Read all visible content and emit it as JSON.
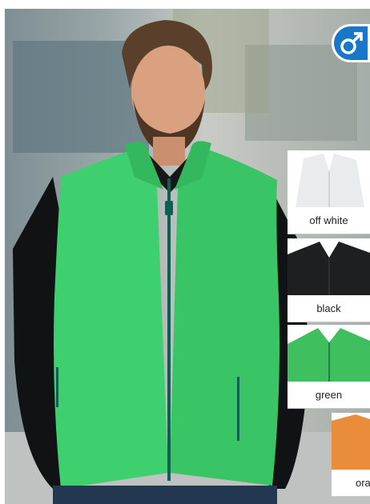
{
  "badge": {
    "icon": "male-symbol-icon",
    "color": "#1877c9"
  },
  "swatches": [
    {
      "label": "off white",
      "color": "#e8ecec",
      "icon": "vest-thumbnail-icon"
    },
    {
      "label": "black",
      "color": "#1e1f21",
      "icon": "vest-thumbnail-icon"
    },
    {
      "label": "green",
      "color": "#3fbf5d",
      "icon": "vest-thumbnail-icon"
    },
    {
      "label": "ora",
      "color": "#e98d3b",
      "icon": "vest-thumbnail-icon"
    }
  ],
  "product": {
    "color": "#3ecf6e",
    "zipper_color": "#0f5e52"
  }
}
